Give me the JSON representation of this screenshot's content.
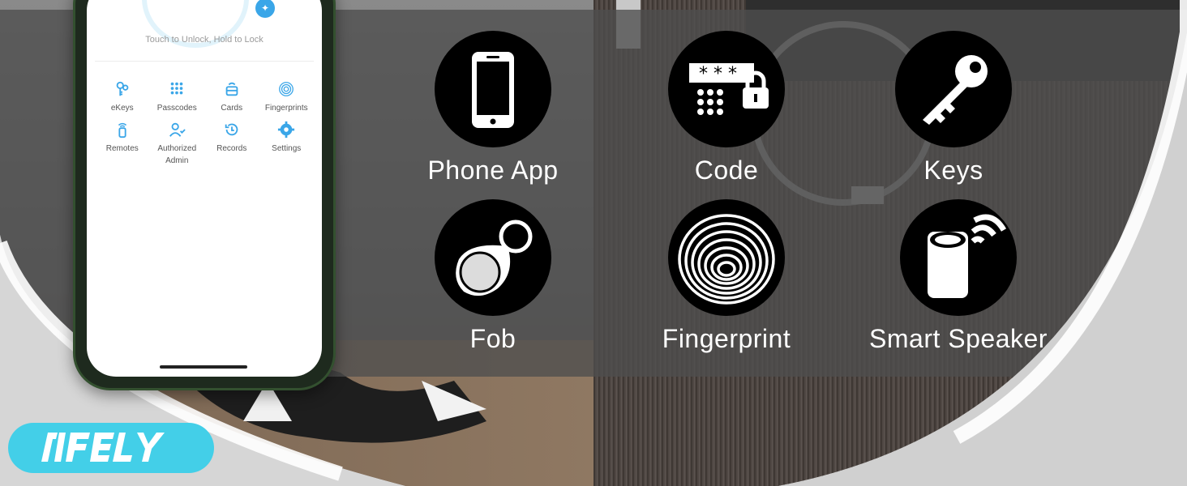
{
  "app": {
    "unlock_hint": "Touch to Unlock, Hold to Lock",
    "menu_items": [
      {
        "label": "eKeys",
        "icon": "key-person-icon"
      },
      {
        "label": "Passcodes",
        "icon": "keypad-icon"
      },
      {
        "label": "Cards",
        "icon": "card-icon"
      },
      {
        "label": "Fingerprints",
        "icon": "fingerprint-icon"
      },
      {
        "label": "Remotes",
        "icon": "remote-icon"
      },
      {
        "label": "Authorized Admin",
        "icon": "admin-icon"
      },
      {
        "label": "Records",
        "icon": "history-icon"
      },
      {
        "label": "Settings",
        "icon": "gear-icon"
      }
    ]
  },
  "features": [
    {
      "label": "Phone App",
      "icon": "smartphone-icon"
    },
    {
      "label": "Code",
      "icon": "keypad-lock-icon"
    },
    {
      "label": "Keys",
      "icon": "key-icon"
    },
    {
      "label": "Fob",
      "icon": "key-fob-icon"
    },
    {
      "label": "Fingerprint",
      "icon": "fingerprint-icon"
    },
    {
      "label": "Smart Speaker",
      "icon": "smart-speaker-icon"
    }
  ],
  "brand": {
    "logo_text": "SIFELY",
    "logo_color": "#43cfe8"
  },
  "colors": {
    "overlay": "#5a5a5a",
    "icon_circle": "#000000",
    "app_accent": "#3aa6e8",
    "label_text": "#ffffff"
  }
}
